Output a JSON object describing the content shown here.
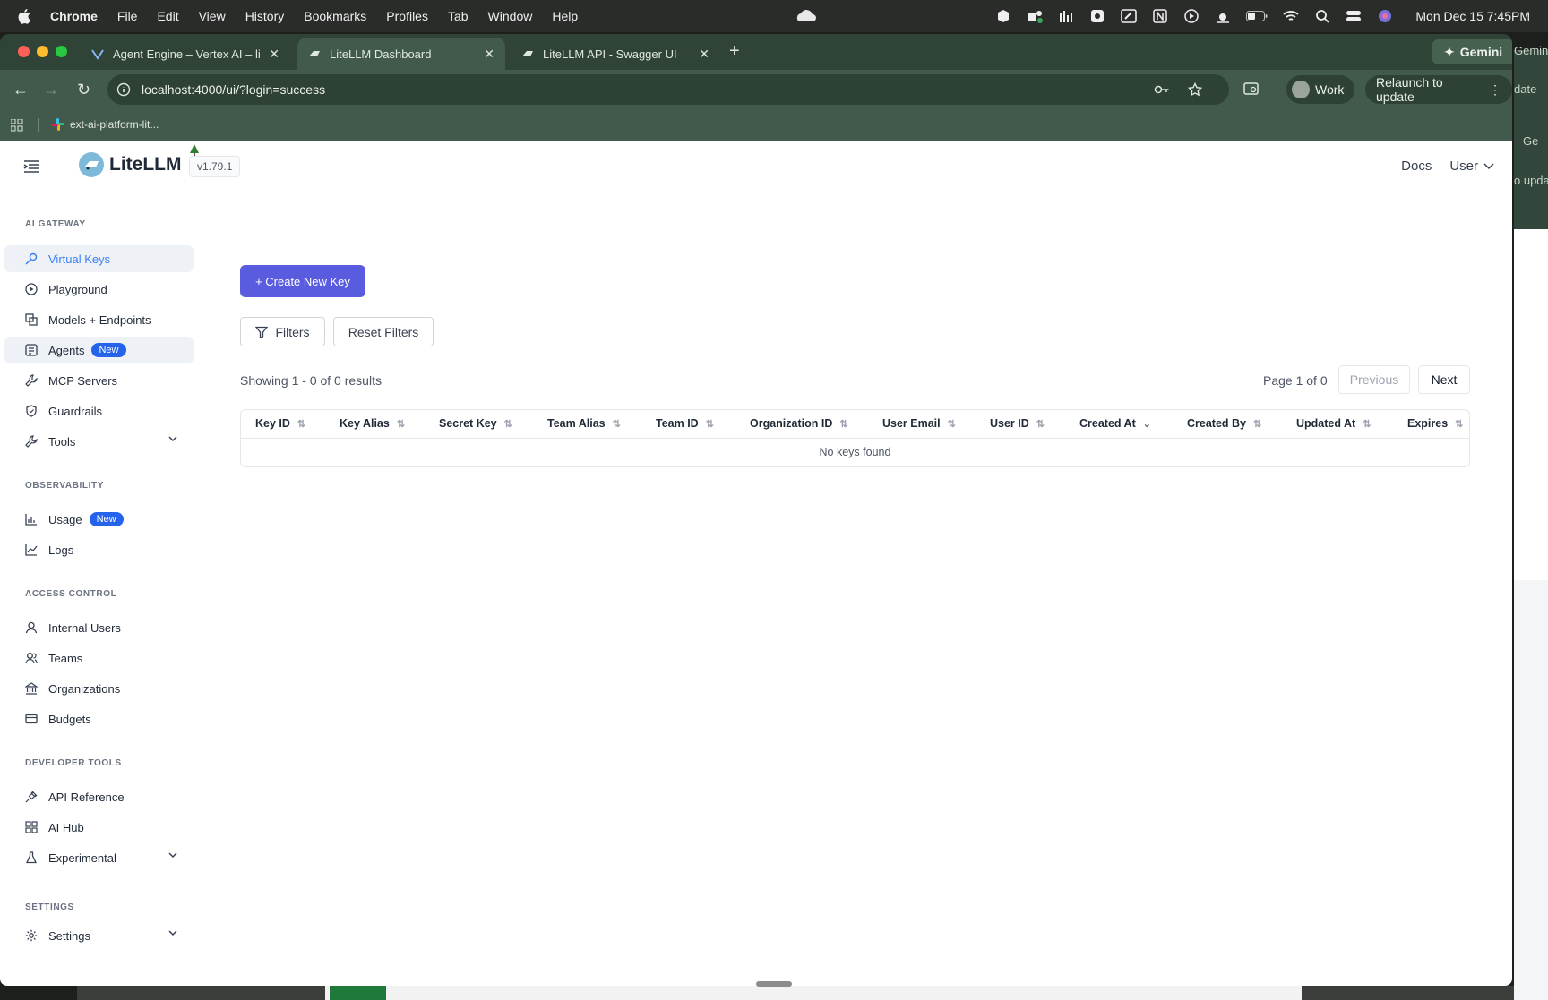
{
  "os_menu": {
    "app": "Chrome",
    "items": [
      "File",
      "Edit",
      "View",
      "History",
      "Bookmarks",
      "Profiles",
      "Tab",
      "Window",
      "Help"
    ],
    "clock": "Mon Dec 15  7:45PM"
  },
  "browser": {
    "tabs": [
      {
        "title": "Agent Engine – Vertex AI – lit"
      },
      {
        "title": "LiteLLM Dashboard"
      },
      {
        "title": "LiteLLM API - Swagger UI"
      }
    ],
    "gemini_label": "Gemini",
    "url": "localhost:4000/ui/?login=success",
    "profile_label": "Work",
    "relaunch_label": "Relaunch to update",
    "bookmark": "ext-ai-platform-lit..."
  },
  "background_window": {
    "gemini_fragment": "Gemini",
    "update_fragment": "date",
    "ge_fragment": "Ge",
    "upda_fragment": "o upda"
  },
  "header": {
    "logo_text": "LiteLLM",
    "version": "v1.79.1",
    "docs_label": "Docs",
    "user_label": "User"
  },
  "sidebar": {
    "sections": [
      {
        "title": "AI GATEWAY"
      },
      {
        "title": "OBSERVABILITY"
      },
      {
        "title": "ACCESS CONTROL"
      },
      {
        "title": "DEVELOPER TOOLS"
      },
      {
        "title": "SETTINGS"
      }
    ],
    "items": [
      {
        "label": "Virtual Keys"
      },
      {
        "label": "Playground"
      },
      {
        "label": "Models + Endpoints"
      },
      {
        "label": "Agents",
        "badge": "New"
      },
      {
        "label": "MCP Servers"
      },
      {
        "label": "Guardrails"
      },
      {
        "label": "Tools"
      },
      {
        "label": "Usage",
        "badge": "New"
      },
      {
        "label": "Logs"
      },
      {
        "label": "Internal Users"
      },
      {
        "label": "Teams"
      },
      {
        "label": "Organizations"
      },
      {
        "label": "Budgets"
      },
      {
        "label": "API Reference"
      },
      {
        "label": "AI Hub"
      },
      {
        "label": "Experimental"
      },
      {
        "label": "Settings"
      }
    ]
  },
  "main": {
    "create_button": "+ Create New Key",
    "filters_button": "Filters",
    "reset_button": "Reset Filters",
    "showing_text": "Showing 1 - 0 of 0 results",
    "page_info": "Page 1 of 0",
    "previous_label": "Previous",
    "next_label": "Next",
    "columns": [
      "Key ID",
      "Key Alias",
      "Secret Key",
      "Team Alias",
      "Team ID",
      "Organization ID",
      "User Email",
      "User ID",
      "Created At",
      "Created By",
      "Updated At",
      "Expires"
    ],
    "empty_text": "No keys found"
  },
  "colors": {
    "accent": "#5a5ce0",
    "active_nav": "#3b82f6",
    "badge": "#2563eb",
    "browser_chrome": "#425a4b"
  }
}
